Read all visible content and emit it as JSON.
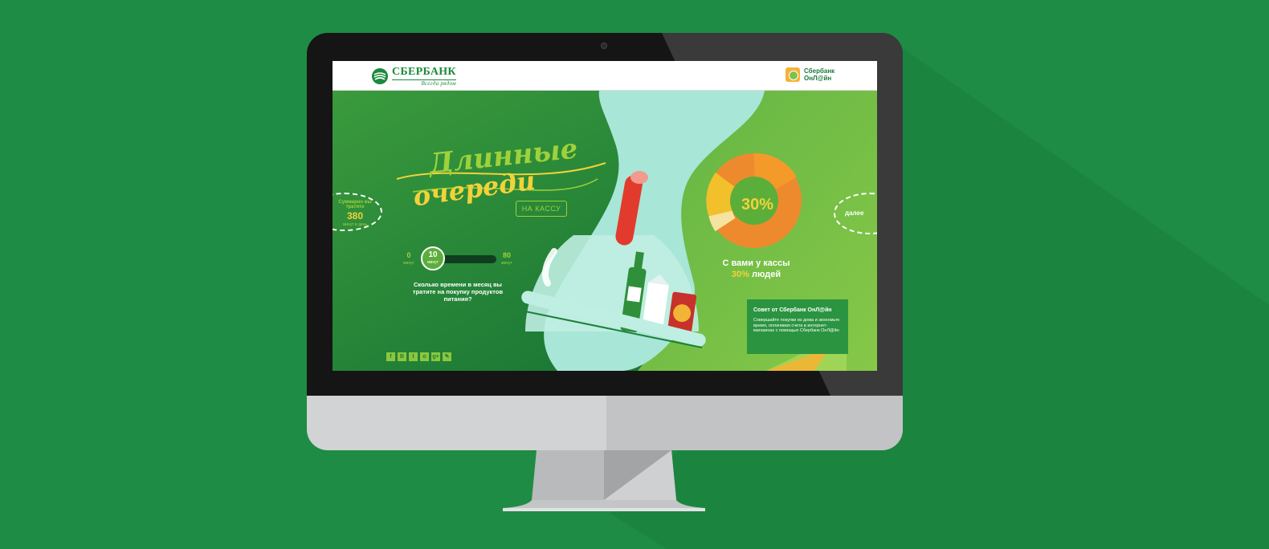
{
  "header": {
    "brand_name": "СБЕРБАНК",
    "brand_slogan": "Всегда рядом",
    "online_line1": "Сбербанк",
    "online_line2": "ОнЛ@йн"
  },
  "hero": {
    "title_line1": "Длинные",
    "title_line2": "очереди",
    "title_tag": "НА КАССУ"
  },
  "total": {
    "label": "Суммарно вы тратите",
    "value": "380",
    "unit": "минут в день"
  },
  "slider": {
    "min_value": "0",
    "min_unit": "минут",
    "max_value": "80",
    "max_unit": "минут",
    "current_value": "10",
    "current_unit": "минут",
    "question": "Сколько времени в месяц вы тратите на покупку продуктов питания?"
  },
  "stat": {
    "percent_label": "30%",
    "line1": "С вами у кассы",
    "line2_pct": "30%",
    "line2_rest": " людей"
  },
  "tip": {
    "title": "Совет от Сбербанк ОнЛ@йн",
    "text": "Совершайте покупки из дома и экономьте время, оплачивая счета в интернет-магазинах с помощью Сбербанк ОнЛ@йн"
  },
  "nav": {
    "next_label": "далее"
  },
  "social": [
    "f",
    "B",
    "t",
    "o",
    "g+",
    "✎"
  ],
  "colors": {
    "page_bg": "#1e8c44",
    "brand_green": "#1b8a3c",
    "accent_yellow": "#f2d23a",
    "accent_lime": "#9fd13a",
    "donut_orange": "#f0922a"
  }
}
